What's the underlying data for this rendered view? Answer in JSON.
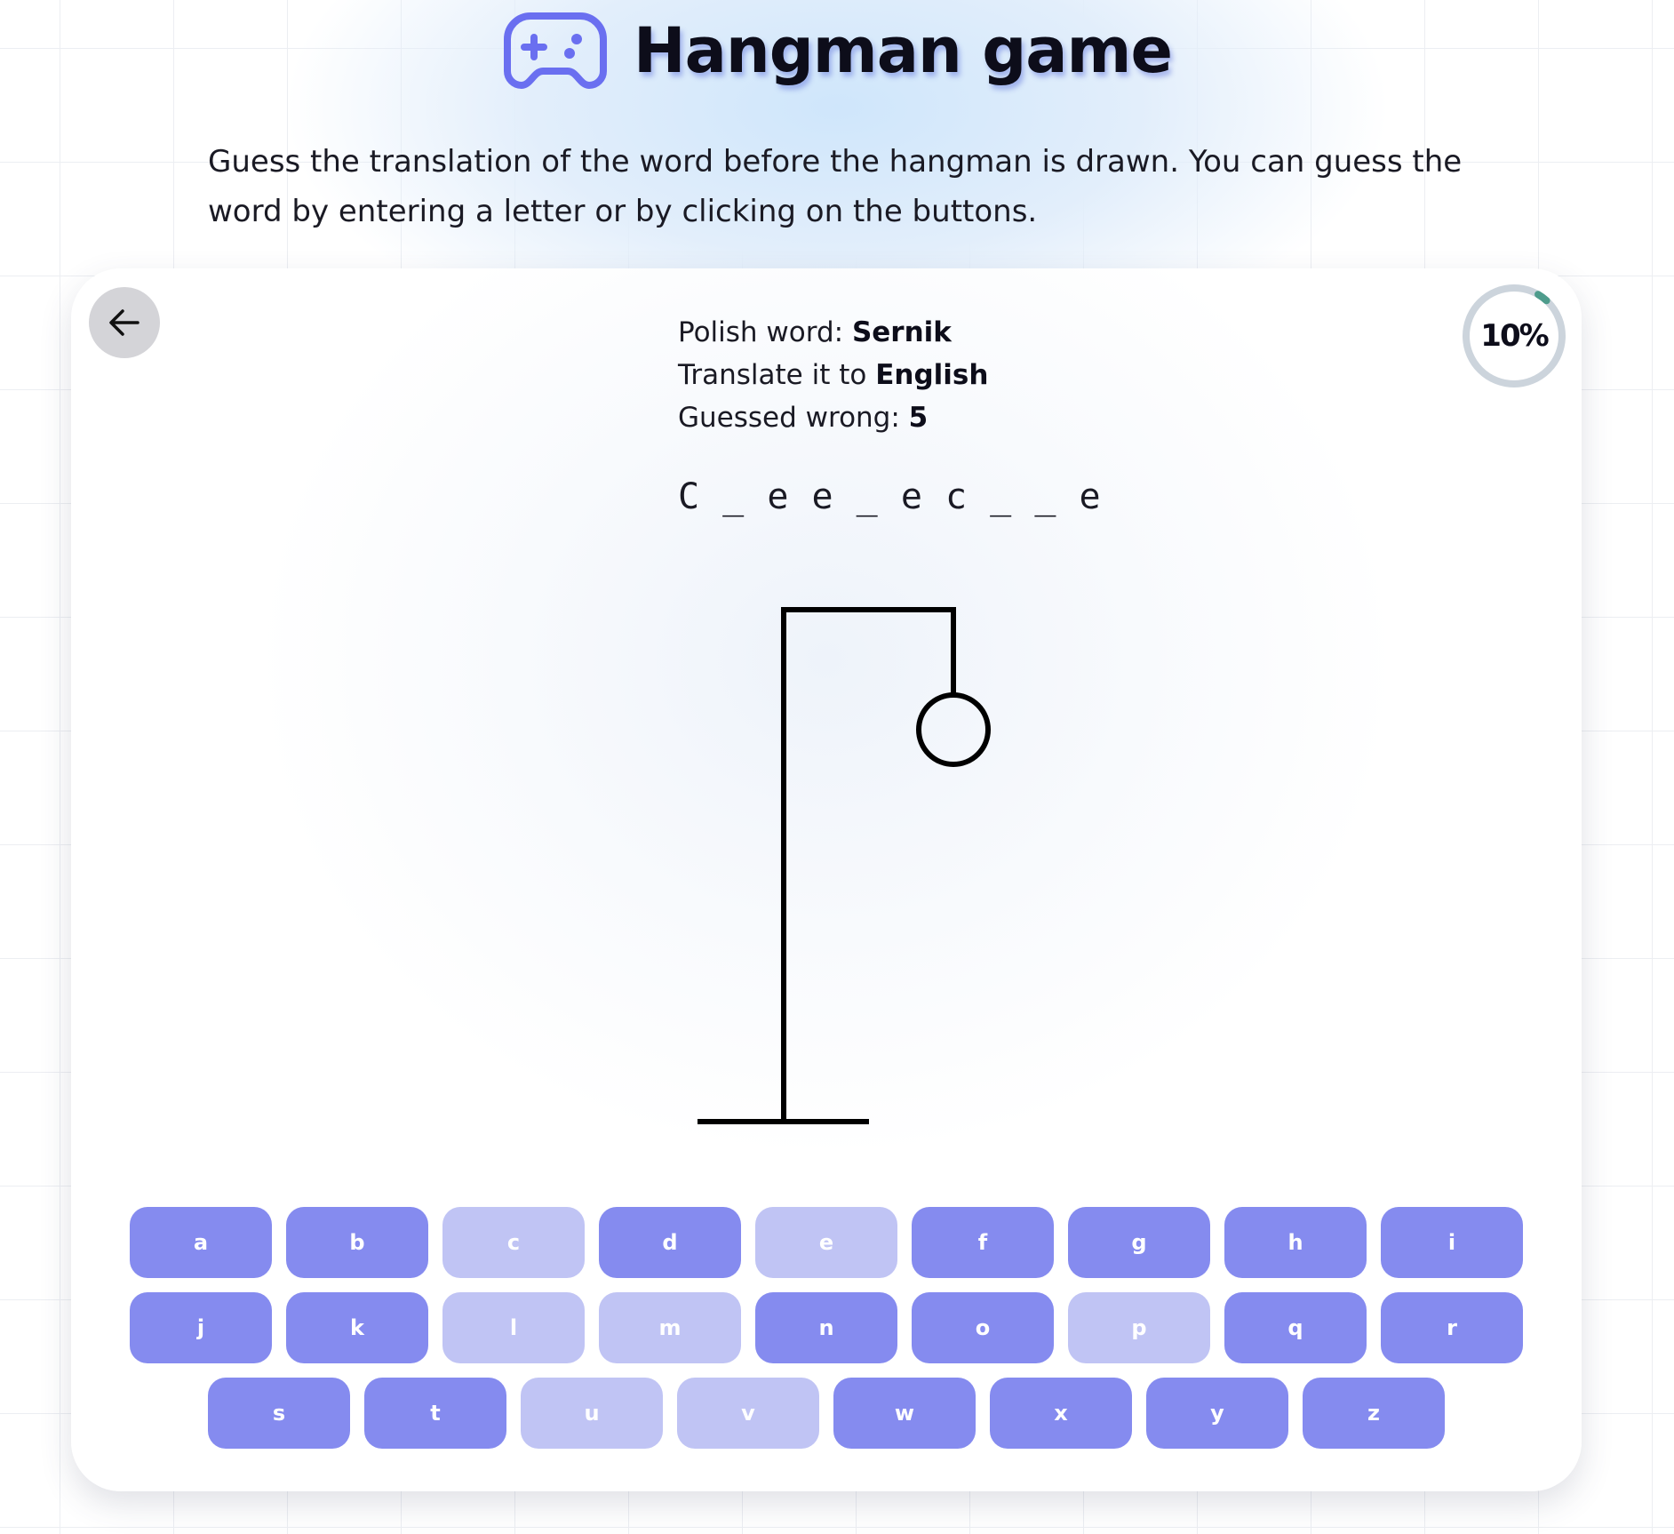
{
  "header": {
    "title": "Hangman game",
    "icon": "gamepad-icon",
    "description": "Guess the translation of the word before the hangman is drawn. You can guess the word by entering a letter or by clicking on the buttons."
  },
  "game": {
    "polish_word_label": "Polish word: ",
    "polish_word": "Sernik",
    "translate_label": "Translate it to ",
    "target_language": "English",
    "wrong_label": "Guessed wrong: ",
    "wrong_count": "5",
    "masked_word": "C_ee_ec__e",
    "progress_label": "10%",
    "progress_fraction": 0.1
  },
  "navigation": {
    "back_icon": "arrow-left-icon"
  },
  "keyboard": {
    "rows": [
      [
        {
          "letter": "a",
          "used": false
        },
        {
          "letter": "b",
          "used": false
        },
        {
          "letter": "c",
          "used": true
        },
        {
          "letter": "d",
          "used": false
        },
        {
          "letter": "e",
          "used": true
        },
        {
          "letter": "f",
          "used": false
        },
        {
          "letter": "g",
          "used": false
        },
        {
          "letter": "h",
          "used": false
        },
        {
          "letter": "i",
          "used": false
        }
      ],
      [
        {
          "letter": "j",
          "used": false
        },
        {
          "letter": "k",
          "used": false
        },
        {
          "letter": "l",
          "used": true
        },
        {
          "letter": "m",
          "used": true
        },
        {
          "letter": "n",
          "used": false
        },
        {
          "letter": "o",
          "used": false
        },
        {
          "letter": "p",
          "used": true
        },
        {
          "letter": "q",
          "used": false
        },
        {
          "letter": "r",
          "used": false
        }
      ],
      [
        {
          "letter": "s",
          "used": false
        },
        {
          "letter": "t",
          "used": false
        },
        {
          "letter": "u",
          "used": true
        },
        {
          "letter": "v",
          "used": true
        },
        {
          "letter": "w",
          "used": false
        },
        {
          "letter": "x",
          "used": false
        },
        {
          "letter": "y",
          "used": false
        },
        {
          "letter": "z",
          "used": false
        }
      ]
    ]
  },
  "colors": {
    "key_active": "#858bef",
    "key_used": "#c0c4f4",
    "accent": "#6a6ff0",
    "progress": "#4e9c8c",
    "progress_track": "#ccd4dc"
  }
}
